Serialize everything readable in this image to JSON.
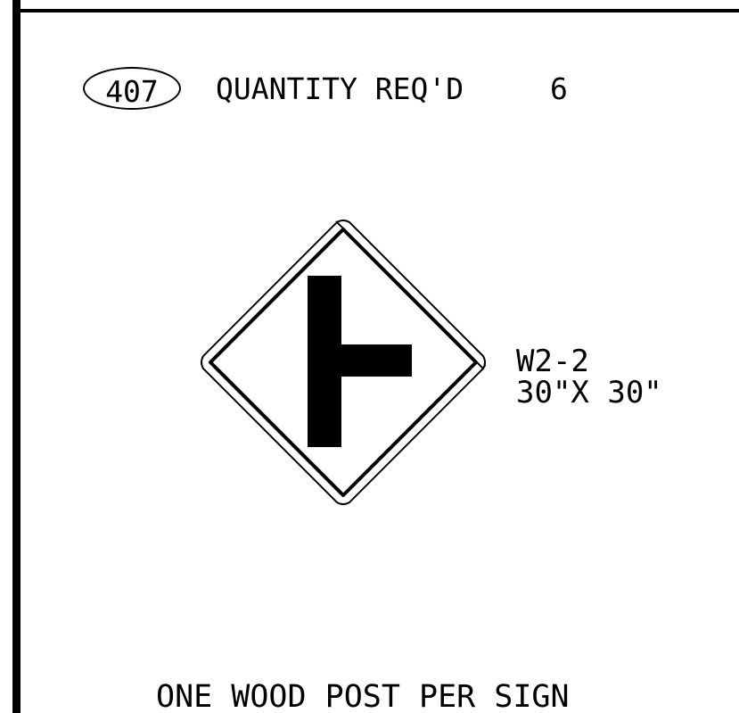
{
  "callout": {
    "number": "407"
  },
  "quantity": {
    "label": "QUANTITY REQ'D",
    "value": "6"
  },
  "sign": {
    "code": "W2-2",
    "size": "30\"X 30\"",
    "symbol": "side-road-t-intersection-symbol",
    "shape": "diamond"
  },
  "note": "ONE WOOD POST PER SIGN",
  "colors": {
    "line": "#000000",
    "background": "#ffffff"
  }
}
